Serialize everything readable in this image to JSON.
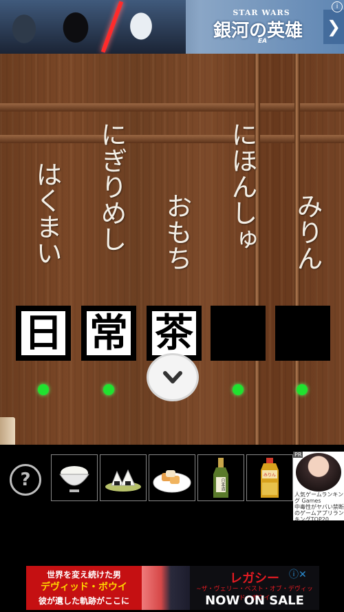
{
  "top_ad": {
    "brand": "STAR WARS",
    "title": "銀河の英雄",
    "publisher": "EA",
    "info_icon": "i",
    "arrow_icon": "❯"
  },
  "scene": {
    "columns": [
      {
        "reading": "はくまい",
        "kanji": "日"
      },
      {
        "reading": "にぎりめし",
        "kanji": "常"
      },
      {
        "reading": "おもち",
        "kanji": "茶"
      },
      {
        "reading": "にほんしゅ",
        "kanji": ""
      },
      {
        "reading": "みりん",
        "kanji": ""
      }
    ],
    "indicator_color": "#20e22f"
  },
  "navigation": {
    "down_icon": "⌄"
  },
  "inventory": {
    "hint_label": "?",
    "items": [
      {
        "icon": "rice-bowl-icon"
      },
      {
        "icon": "rice-balls-icon"
      },
      {
        "icon": "mochi-plate-icon"
      },
      {
        "icon": "sake-bottle-icon",
        "label": "日本酒"
      },
      {
        "icon": "mirin-bottle-icon",
        "label": "みりん"
      }
    ]
  },
  "side_ad": {
    "badge": "PR",
    "line1": "人気ゲームランキング Games",
    "line2": "中毒性がヤバい禁断のゲームアプリランキングTOP20"
  },
  "bottom_ad": {
    "left_line1": "世界を変え続けた男",
    "left_line2": "デヴィッド・ボウイ",
    "left_line3": "彼が遺した軌跡がここに",
    "right_title": "レガシー",
    "right_subtitle": "~ザ・ヴェリー・ベスト・オブ・デヴィッド・ボウイ",
    "right_cta": "NOW ON SALE",
    "info_icons": "ⓘ✕"
  }
}
